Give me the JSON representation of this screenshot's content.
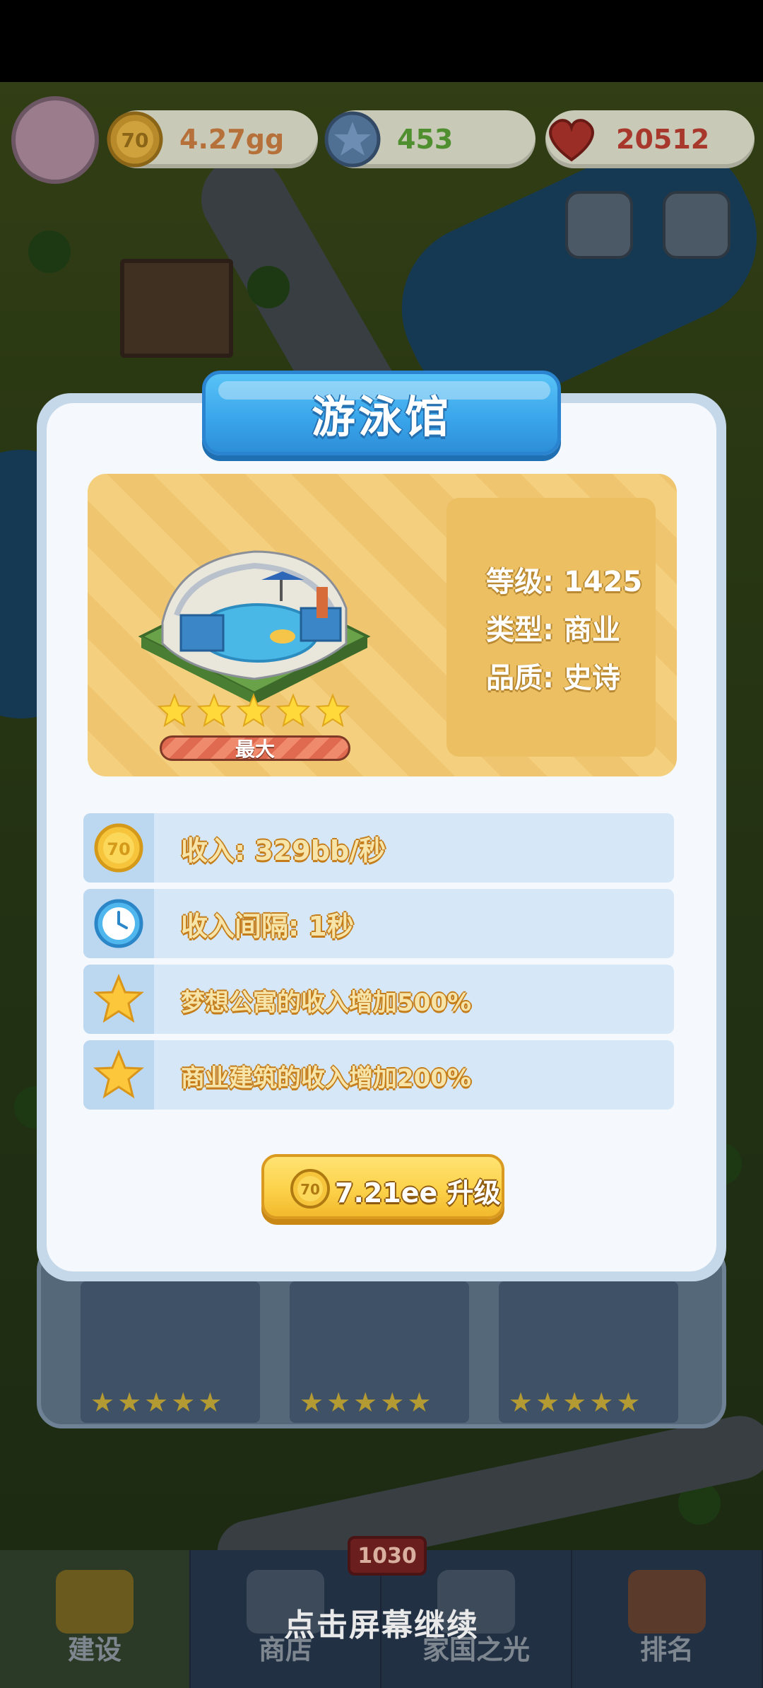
{
  "hud": {
    "coins": "4.27gg",
    "gems": "453",
    "hearts": "20512",
    "coin_color": "#e2a43a",
    "gem_color": "#59b441",
    "heart_color": "#d84a3c"
  },
  "nav": {
    "items": [
      {
        "label": "建设",
        "icon": "hardhat-icon"
      },
      {
        "label": "商店",
        "icon": "shop-icon"
      },
      {
        "label": "家国之光",
        "icon": "hero-icon"
      },
      {
        "label": "排名",
        "icon": "ranking-icon"
      }
    ],
    "shop_badge": "1030"
  },
  "continue_hint": "点击屏幕继续",
  "modal": {
    "title": "游泳馆",
    "stars": 5,
    "level_state": "最大",
    "stats": {
      "level": "等级: 1425",
      "type": "类型: 商业",
      "quality": "品质: 史诗"
    },
    "rows": [
      {
        "icon": "coin-icon",
        "text": "收入: 329bb/秒"
      },
      {
        "icon": "clock-icon",
        "text": "收入间隔: 1秒"
      },
      {
        "icon": "star-icon",
        "text": "梦想公寓的收入增加500%"
      },
      {
        "icon": "star-icon",
        "text": "商业建筑的收入增加200%"
      }
    ],
    "upgrade": {
      "price": "7.21ee",
      "label": "升级",
      "full": "7.21ee  升级"
    }
  },
  "background_cards": [
    {
      "stars": 5
    },
    {
      "stars": 5
    },
    {
      "stars": 5
    }
  ]
}
